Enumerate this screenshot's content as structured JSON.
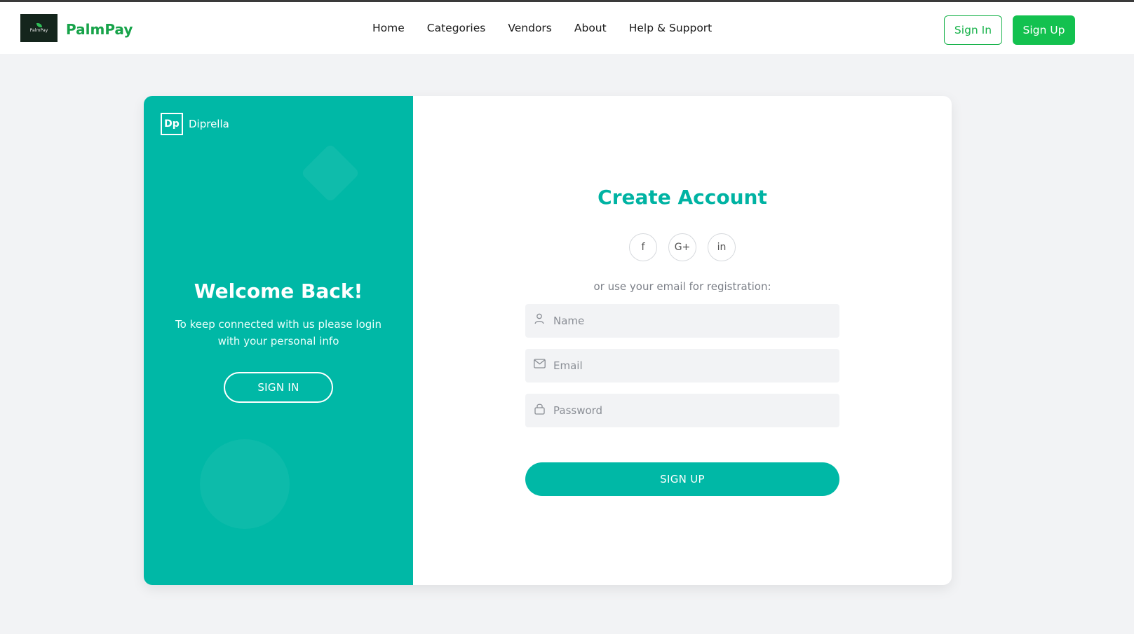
{
  "brand": {
    "logo_text": "PalmPay",
    "name": "PalmPay"
  },
  "nav": {
    "items": [
      {
        "label": "Home"
      },
      {
        "label": "Categories"
      },
      {
        "label": "Vendors"
      },
      {
        "label": "About"
      },
      {
        "label": "Help & Support"
      }
    ]
  },
  "header_actions": {
    "sign_in_label": "Sign In",
    "sign_up_label": "Sign Up"
  },
  "left_panel": {
    "badge": "Dp",
    "brand_name": "Diprella",
    "title": "Welcome Back!",
    "message": "To keep connected with us please login with your personal info",
    "button_label": "SIGN IN"
  },
  "form": {
    "title": "Create Account",
    "socials": [
      {
        "label": "f",
        "icon": "facebook-icon"
      },
      {
        "label": "G+",
        "icon": "google-plus-icon"
      },
      {
        "label": "in",
        "icon": "linkedin-icon"
      }
    ],
    "divider_text": "or use your email for registration:",
    "name_placeholder": "Name",
    "email_placeholder": "Email",
    "password_placeholder": "Password",
    "submit_label": "SIGN UP"
  },
  "colors": {
    "teal": "#00b8a6",
    "brand_green": "#17a34a",
    "button_green": "#13c14f"
  }
}
